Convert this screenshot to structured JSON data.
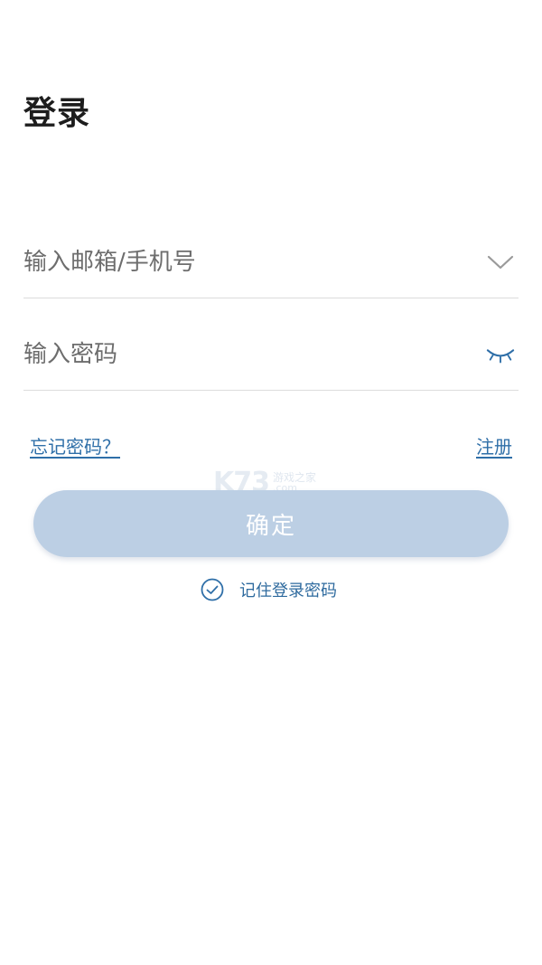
{
  "header": {
    "title": "登录"
  },
  "form": {
    "account_placeholder": "输入邮箱/手机号",
    "password_placeholder": "输入密码"
  },
  "links": {
    "forgot_password": "忘记密码？",
    "register": "注册"
  },
  "confirm_label": "确定",
  "remember_label": "记住登录密码",
  "watermark": {
    "brand": "K73",
    "site_cn": "游戏之家",
    "domain": ".com"
  },
  "icons": {
    "account_dropdown": "chevron-down-icon",
    "password_visibility": "eye-closed-icon",
    "remember_check": "check-circle-icon"
  },
  "colors": {
    "accent": "#2f6fa8",
    "button_disabled": "#bccfe4",
    "divider": "#dcdcdc"
  }
}
